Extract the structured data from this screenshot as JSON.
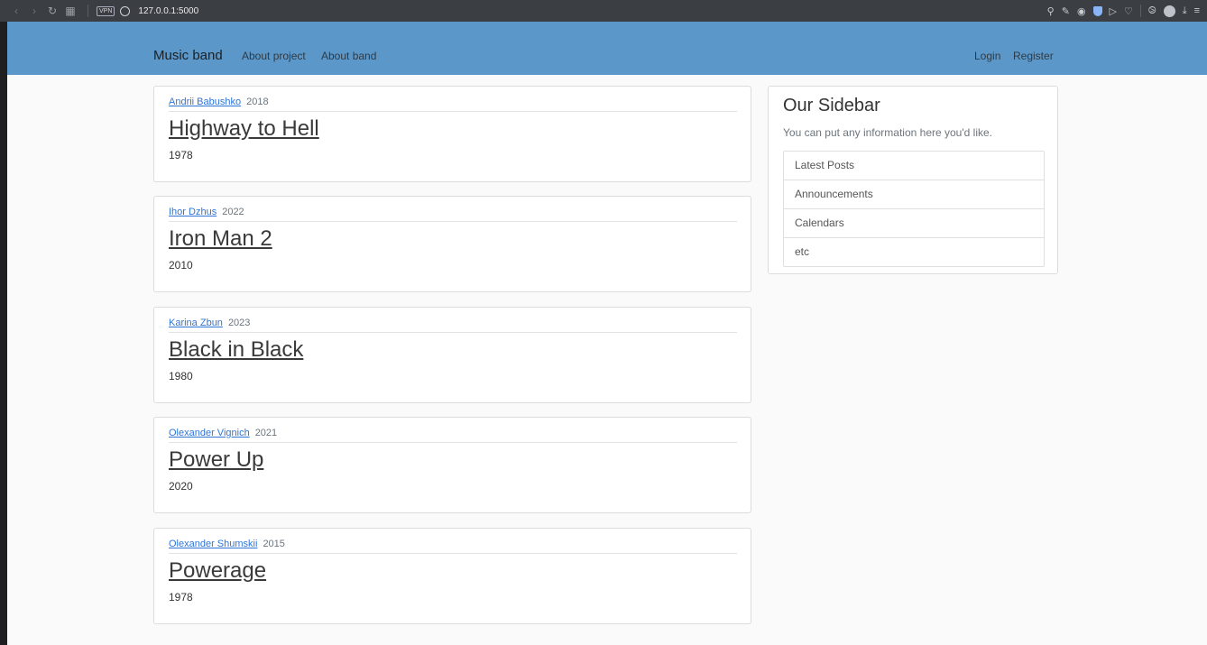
{
  "browser": {
    "url": "127.0.0.1:5000",
    "vpn_label": "VPN"
  },
  "navbar": {
    "brand": "Music band",
    "links": [
      "About project",
      "About band"
    ],
    "login": "Login",
    "register": "Register"
  },
  "posts": [
    {
      "author": "Andrii Babushko",
      "date": "2018",
      "title": "Highway to Hell",
      "content": "1978"
    },
    {
      "author": "Ihor Dzhus",
      "date": "2022",
      "title": "Iron Man 2",
      "content": "2010"
    },
    {
      "author": "Karina Zbun",
      "date": "2023",
      "title": "Black in Black",
      "content": "1980"
    },
    {
      "author": "Olexander Vignich",
      "date": "2021",
      "title": "Power Up",
      "content": "2020"
    },
    {
      "author": "Olexander Shumskii",
      "date": "2015",
      "title": "Powerage",
      "content": "1978"
    }
  ],
  "sidebar": {
    "title": "Our Sidebar",
    "description": "You can put any information here you'd like.",
    "items": [
      "Latest Posts",
      "Announcements",
      "Calendars",
      "etc"
    ]
  },
  "colors": {
    "navbar": "#5b98c9",
    "link": "#2f75d6",
    "page_bg": "#fafafa",
    "chrome_bg": "#3b3e42"
  }
}
